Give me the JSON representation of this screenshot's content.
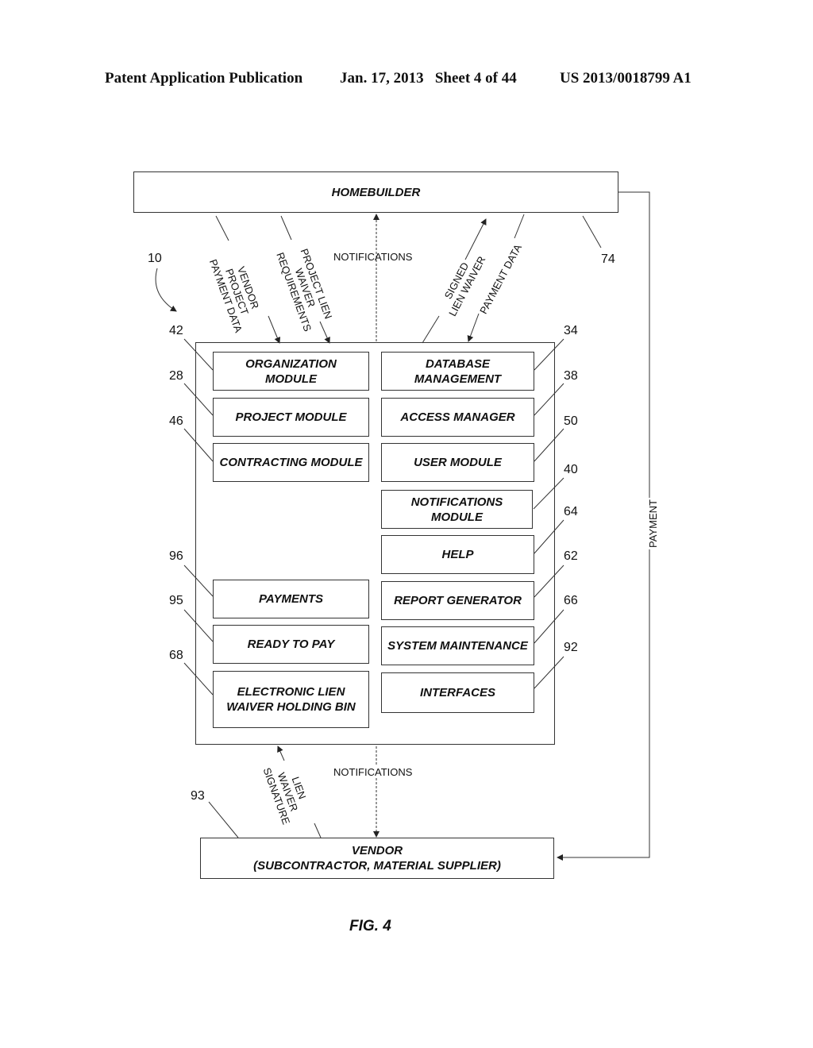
{
  "header": {
    "publication": "Patent Application Publication",
    "date_sheet": "Jan. 17, 2013   Sheet 4 of 44",
    "number": "US 2013/0018799 A1"
  },
  "diagram": {
    "homebuilder": {
      "label": "HOMEBUILDER",
      "ref": "74"
    },
    "system": {
      "ref": "10"
    },
    "vendor": {
      "label": "VENDOR\n(SUBCONTRACTOR, MATERIAL SUPPLIER)",
      "ref": "93"
    },
    "left_modules": [
      {
        "label": "ORGANIZATION\nMODULE",
        "ref": "42"
      },
      {
        "label": "PROJECT MODULE",
        "ref": "28"
      },
      {
        "label": "CONTRACTING MODULE",
        "ref": "46"
      },
      {
        "label": "PAYMENTS",
        "ref": "96"
      },
      {
        "label": "READY TO PAY",
        "ref": "95"
      },
      {
        "label": "ELECTRONIC LIEN\nWAIVER HOLDING BIN",
        "ref": "68"
      }
    ],
    "right_modules": [
      {
        "label": "DATABASE\nMANAGEMENT",
        "ref": "34"
      },
      {
        "label": "ACCESS MANAGER",
        "ref": "38"
      },
      {
        "label": "USER MODULE",
        "ref": "50"
      },
      {
        "label": "NOTIFICATIONS\nMODULE",
        "ref": "40"
      },
      {
        "label": "HELP",
        "ref": "64"
      },
      {
        "label": "REPORT GENERATOR",
        "ref": "62"
      },
      {
        "label": "SYSTEM MAINTENANCE",
        "ref": "66"
      },
      {
        "label": "INTERFACES",
        "ref": "92"
      }
    ],
    "flows": {
      "vendor_project_payment_data": "VENDOR\nPROJECT\nPAYMENT DATA",
      "project_lien_waiver_requirements": "PROJECT LIEN\nWAIVER\nREQUIREMENTS",
      "notifications_top": "NOTIFICATIONS",
      "signed_lien_waiver": "SIGNED\nLIEN WAIVER",
      "payment_data": "PAYMENT DATA",
      "lien_waiver_signature": "LIEN\nWAIVER\nSIGNATURE",
      "notifications_bottom": "NOTIFICATIONS",
      "payment": "PAYMENT"
    },
    "figure_label": "FIG. 4"
  }
}
